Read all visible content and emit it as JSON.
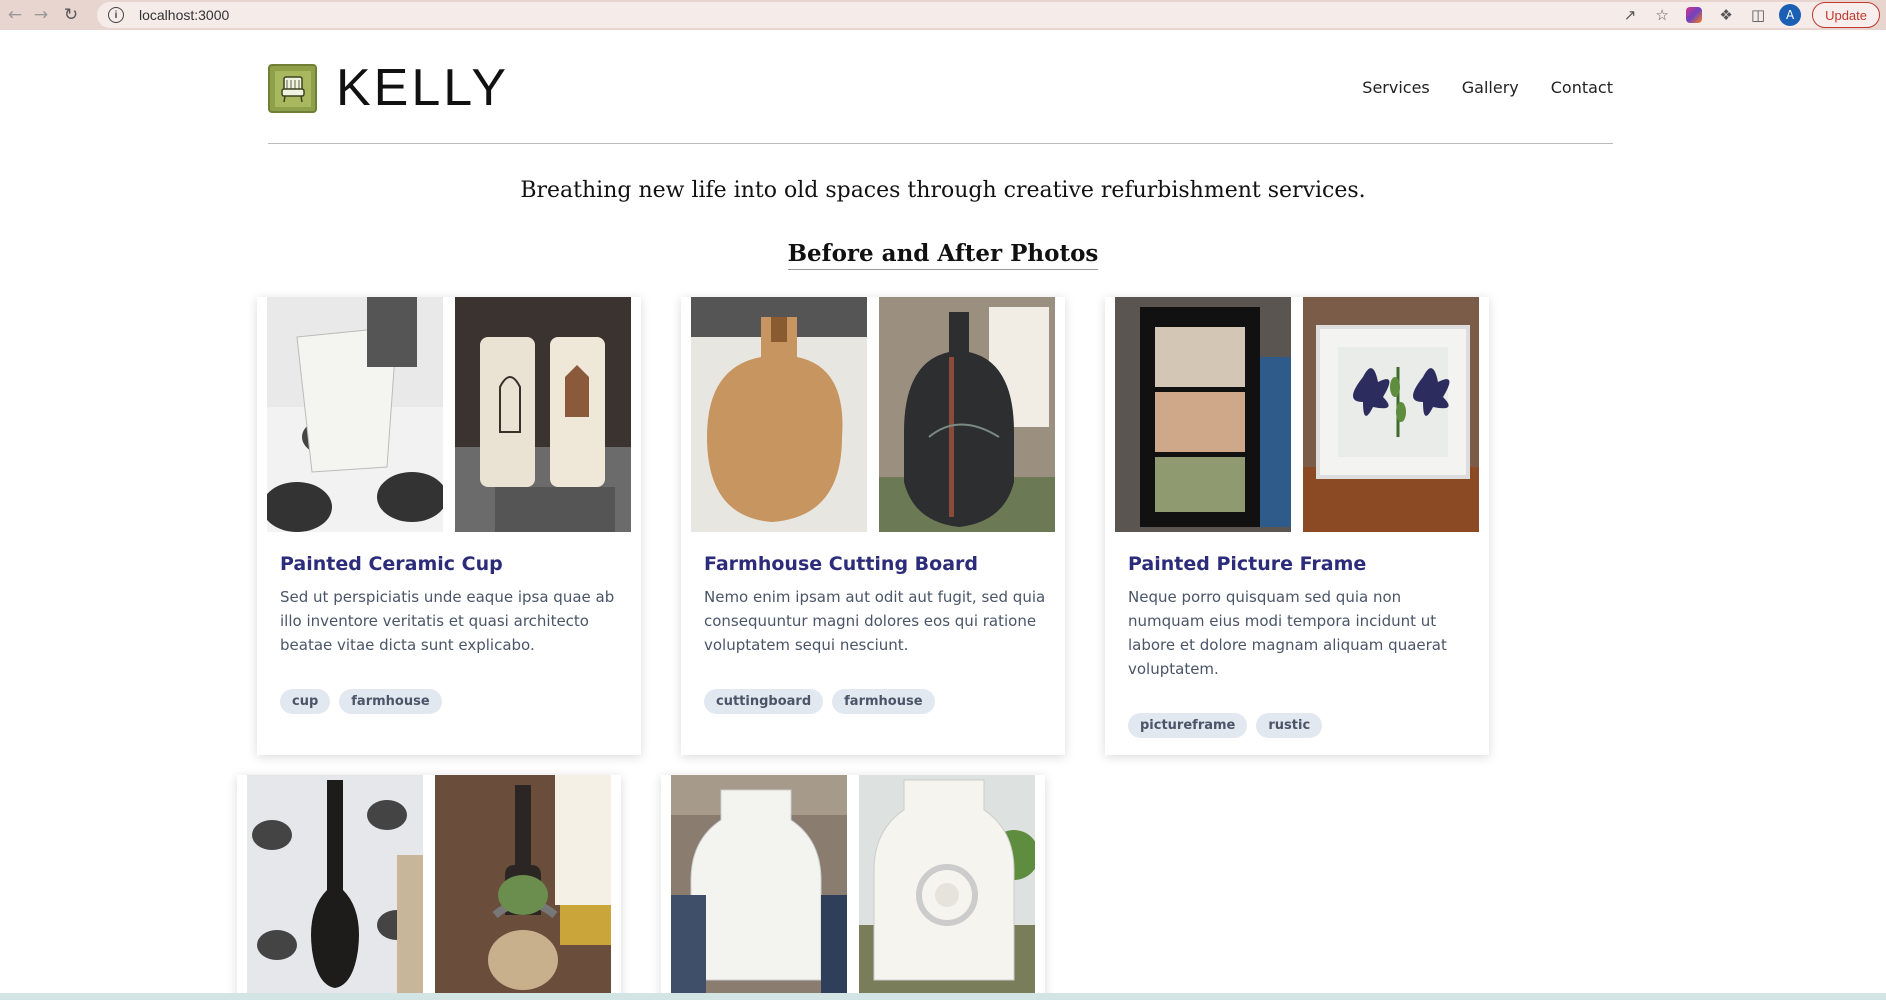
{
  "browser": {
    "url": "localhost:3000",
    "update_label": "Update",
    "avatar_letter": "A"
  },
  "site": {
    "brand": "KELLY",
    "nav": [
      "Services",
      "Gallery",
      "Contact"
    ],
    "tagline": "Breathing new life into old spaces through creative refurbishment services.",
    "section_title": "Before and After Photos"
  },
  "cards": [
    {
      "title": "Painted Ceramic Cup",
      "description": "Sed ut perspiciatis unde eaque ipsa quae ab illo inventore veritatis et quasi architecto beatae vitae dicta sunt explicabo.",
      "tags": [
        "cup",
        "farmhouse"
      ]
    },
    {
      "title": "Farmhouse Cutting Board",
      "description": "Nemo enim ipsam aut odit aut fugit, sed quia consequuntur magni dolores eos qui ratione voluptatem sequi nesciunt.",
      "tags": [
        "cuttingboard",
        "farmhouse"
      ]
    },
    {
      "title": "Painted Picture Frame",
      "description": "Neque porro quisquam sed quia non numquam eius modi tempora incidunt ut labore et dolore magnam aliquam quaerat voluptatem.",
      "tags": [
        "pictureframe",
        "rustic"
      ]
    }
  ],
  "colors": {
    "title": "#2d2c7a",
    "tag_bg": "#e2e8f0",
    "logo_green": "#8fa04a"
  }
}
